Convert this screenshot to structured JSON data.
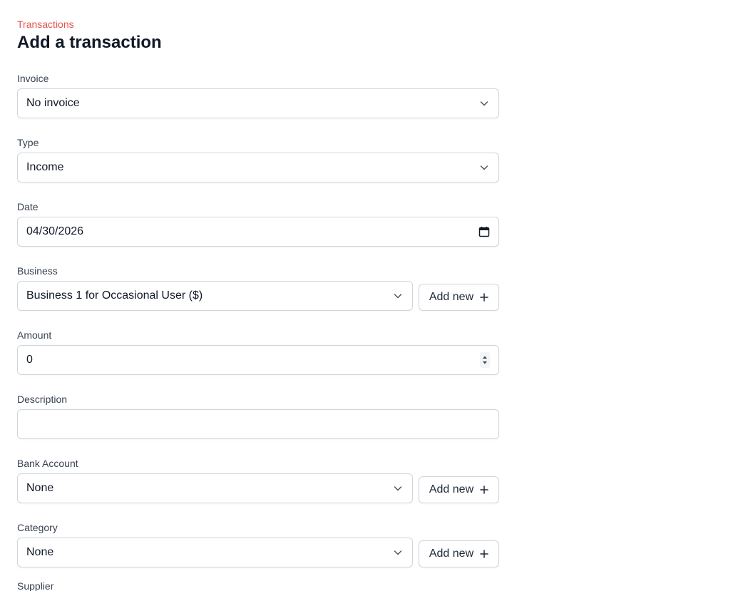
{
  "breadcrumb": {
    "label": "Transactions"
  },
  "page": {
    "title": "Add a transaction"
  },
  "form": {
    "invoice": {
      "label": "Invoice",
      "value": "No invoice"
    },
    "type": {
      "label": "Type",
      "value": "Income"
    },
    "date": {
      "label": "Date",
      "value": "04/30/2026"
    },
    "business": {
      "label": "Business",
      "value": "Business 1 for Occasional User ($)",
      "add_label": "Add new"
    },
    "amount": {
      "label": "Amount",
      "value": "0"
    },
    "description": {
      "label": "Description",
      "value": ""
    },
    "bank_account": {
      "label": "Bank Account",
      "value": "None",
      "add_label": "Add new"
    },
    "category": {
      "label": "Category",
      "value": "None",
      "add_label": "Add new"
    },
    "supplier": {
      "label": "Supplier"
    }
  },
  "theme": {
    "accent": "#e5534b",
    "border": "#d1d5db",
    "text": "#111827"
  },
  "icons": {
    "select": "chevron-down-icon",
    "add": "plus-icon",
    "date": "calendar-icon",
    "amount": "spinner-icon"
  }
}
